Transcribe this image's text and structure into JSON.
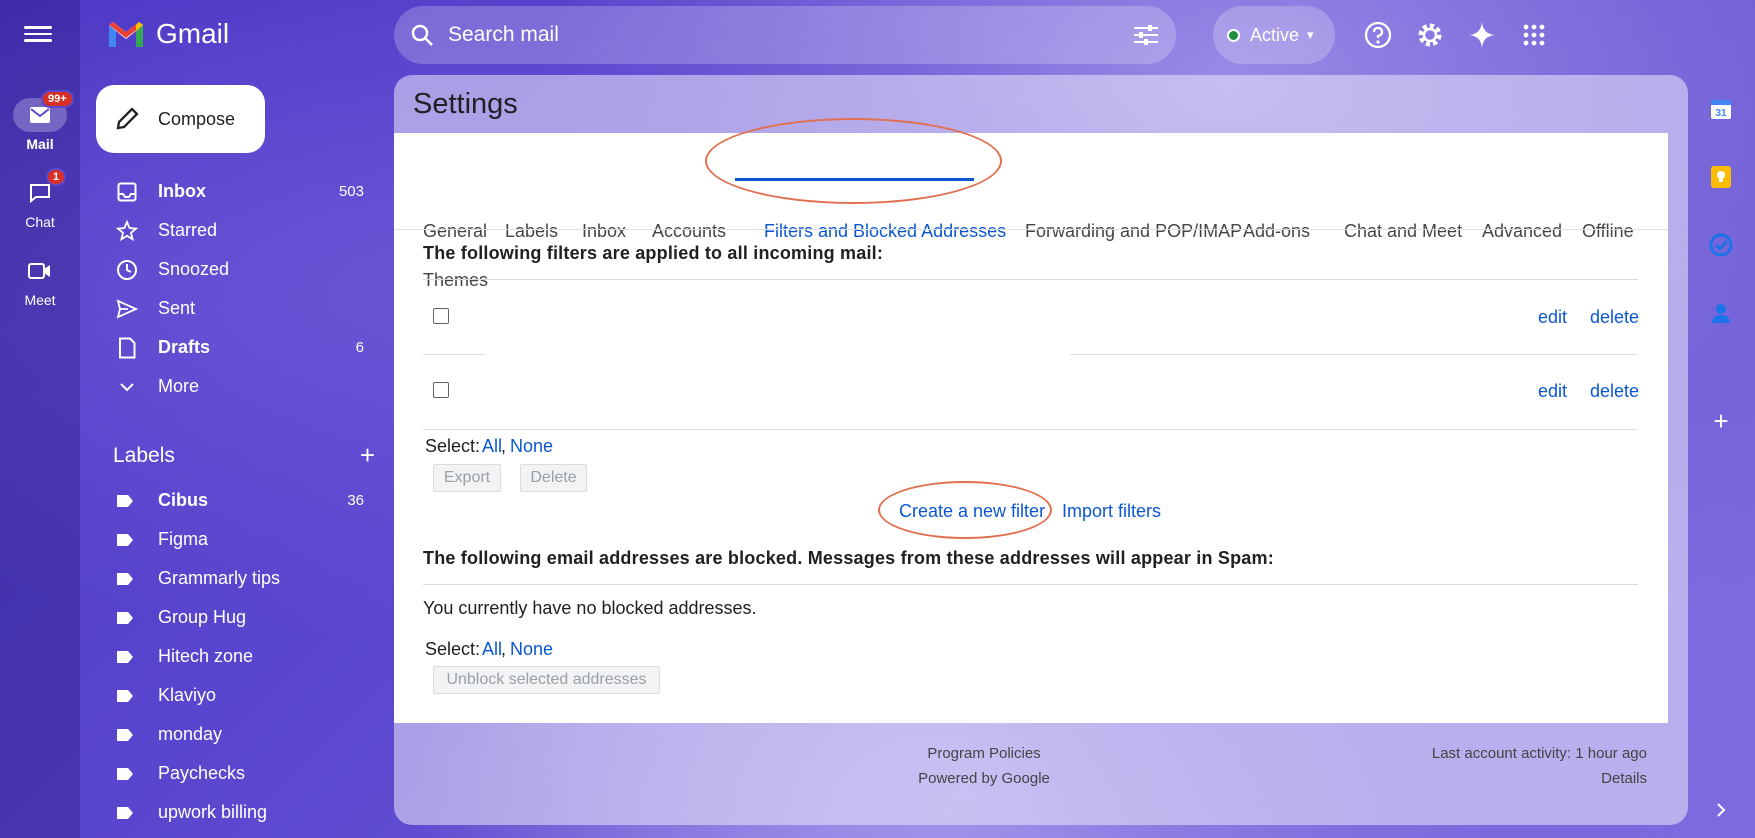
{
  "app": {
    "logo_text": "Gmail"
  },
  "rail": {
    "mail": {
      "label": "Mail",
      "badge": "99+"
    },
    "chat": {
      "label": "Chat",
      "badge": "1"
    },
    "meet": {
      "label": "Meet"
    }
  },
  "search": {
    "placeholder": "Search mail"
  },
  "status": {
    "label": "Active",
    "color": "#1e8e3e"
  },
  "compose_label": "Compose",
  "nav": [
    {
      "label": "Inbox",
      "count": "503",
      "icon": "inbox-icon"
    },
    {
      "label": "Starred",
      "count": "",
      "icon": "star-icon"
    },
    {
      "label": "Snoozed",
      "count": "",
      "icon": "clock-icon"
    },
    {
      "label": "Sent",
      "count": "",
      "icon": "send-icon"
    },
    {
      "label": "Drafts",
      "count": "6",
      "icon": "draft-icon"
    },
    {
      "label": "More",
      "count": "",
      "icon": "chevron-down-icon"
    }
  ],
  "labels": {
    "heading": "Labels",
    "items": [
      {
        "label": "Cibus",
        "count": "36"
      },
      {
        "label": "Figma",
        "count": ""
      },
      {
        "label": "Grammarly tips",
        "count": ""
      },
      {
        "label": "Group Hug",
        "count": ""
      },
      {
        "label": "Hitech zone",
        "count": ""
      },
      {
        "label": "Klaviyo",
        "count": ""
      },
      {
        "label": "monday",
        "count": ""
      },
      {
        "label": "Paychecks",
        "count": ""
      },
      {
        "label": "upwork billing",
        "count": ""
      }
    ]
  },
  "settings": {
    "title": "Settings",
    "tabs": [
      "General",
      "Labels",
      "Inbox",
      "Accounts",
      "Filters and Blocked Addresses",
      "Forwarding and POP/IMAP",
      "Add-ons",
      "Chat and Meet",
      "Advanced",
      "Offline",
      "Themes"
    ],
    "active_tab": "Filters and Blocked Addresses",
    "filters_heading": "The following filters are applied to all incoming mail:",
    "filter_rows": [
      {
        "edit": "edit",
        "delete": "delete"
      },
      {
        "edit": "edit",
        "delete": "delete"
      }
    ],
    "select_label": "Select:",
    "select_all": "All",
    "select_none": "None",
    "export_label": "Export",
    "delete_label": "Delete",
    "create_filter": "Create a new filter",
    "import_filters": "Import filters",
    "blocked_heading": "The following email addresses are blocked. Messages from these addresses will appear in Spam:",
    "no_blocked": "You currently have no blocked addresses.",
    "unblock_label": "Unblock selected addresses"
  },
  "footer": {
    "program_policies": "Program Policies",
    "powered_by": "Powered by Google",
    "last_activity": "Last account activity: 1 hour ago",
    "details": "Details"
  },
  "annotation_color": "#e07050"
}
